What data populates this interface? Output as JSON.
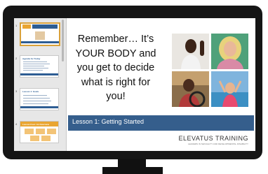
{
  "sidebar": {
    "slides": [
      {
        "number": "1",
        "title": ""
      },
      {
        "number": "2",
        "title": "Agenda for Today"
      },
      {
        "number": "3",
        "title": "Lesson 1: Goals"
      },
      {
        "number": "4",
        "title": "Lesson Four: An Overview"
      }
    ]
  },
  "slide": {
    "quote": "Remember… It’s YOUR BODY and you get to decide what is right for you!",
    "lesson_title": "Lesson 1: Getting Started",
    "brand_name": "ELEVATUS TRAINING",
    "brand_tagline": "LEADERS IN SEXUALITY AND DEVELOPMENTAL DISABILITY"
  }
}
